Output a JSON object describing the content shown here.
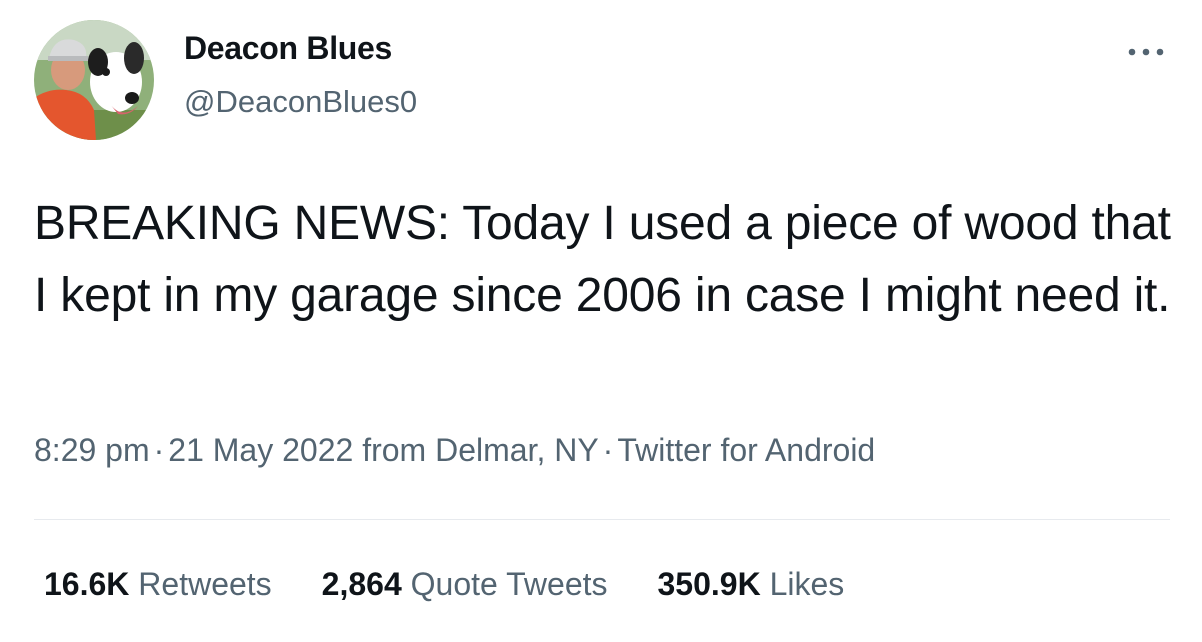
{
  "author": {
    "display_name": "Deacon Blues",
    "handle": "@DeaconBlues0"
  },
  "more_icon": "more-horizontal-icon",
  "tweet": {
    "text": "BREAKING NEWS: Today I used a piece of wood that I kept in my garage since 2006 in case I might need it."
  },
  "meta": {
    "time": "8:29 pm",
    "separator": "·",
    "date": "21 May 2022",
    "location": "from Delmar, NY",
    "source": "Twitter for Android"
  },
  "stats": {
    "retweets_count": "16.6K",
    "retweets_label": "Retweets",
    "quotes_count": "2,864",
    "quotes_label": "Quote Tweets",
    "likes_count": "350.9K",
    "likes_label": "Likes"
  },
  "colors": {
    "text_primary": "#0f1419",
    "text_secondary": "#536471",
    "divider": "#e7eaee"
  }
}
